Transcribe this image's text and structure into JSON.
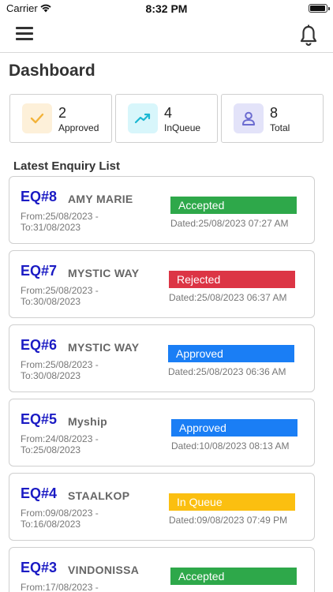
{
  "status_bar": {
    "carrier": "Carrier",
    "time": "8:32 PM"
  },
  "page": {
    "title": "Dashboard"
  },
  "stats": [
    {
      "count": "2",
      "label": "Approved",
      "icon": "check-icon",
      "bg": "#fdf0d9",
      "color": "#f3b33a"
    },
    {
      "count": "4",
      "label": "InQueue",
      "icon": "trending-up-icon",
      "bg": "#d8f6fb",
      "color": "#1ab7d2"
    },
    {
      "count": "8",
      "label": "Total",
      "icon": "user-icon",
      "bg": "#e3e3f9",
      "color": "#6b6bd0"
    }
  ],
  "section": {
    "title": "Latest Enquiry List"
  },
  "enquiries": [
    {
      "id": "EQ#8",
      "name": "AMY MARIE",
      "from": "From:25/08/2023 -",
      "to": "To:31/08/2023",
      "status": "Accepted",
      "status_color": "#2ea84a",
      "dated": "Dated:25/08/2023 07:27 AM"
    },
    {
      "id": "EQ#7",
      "name": "MYSTIC WAY",
      "from": "From:25/08/2023 -",
      "to": "To:30/08/2023",
      "status": "Rejected",
      "status_color": "#dc3545",
      "dated": "Dated:25/08/2023 06:37 AM"
    },
    {
      "id": "EQ#6",
      "name": "MYSTIC WAY",
      "from": "From:25/08/2023 -",
      "to": "To:30/08/2023",
      "status": "Approved",
      "status_color": "#1a7ef5",
      "dated": "Dated:25/08/2023 06:36 AM"
    },
    {
      "id": "EQ#5",
      "name": "Myship",
      "from": "From:24/08/2023 -",
      "to": "To:25/08/2023",
      "status": "Approved",
      "status_color": "#1a7ef5",
      "dated": "Dated:10/08/2023 08:13 AM"
    },
    {
      "id": "EQ#4",
      "name": "STAALKOP",
      "from": "From:09/08/2023 -",
      "to": "To:16/08/2023",
      "status": "In Queue",
      "status_color": "#fbbf10",
      "dated": "Dated:09/08/2023 07:49 PM"
    },
    {
      "id": "EQ#3",
      "name": "VINDONISSA",
      "from": "From:17/08/2023 -",
      "to": "",
      "status": "Accepted",
      "status_color": "#2ea84a",
      "dated": ""
    }
  ]
}
